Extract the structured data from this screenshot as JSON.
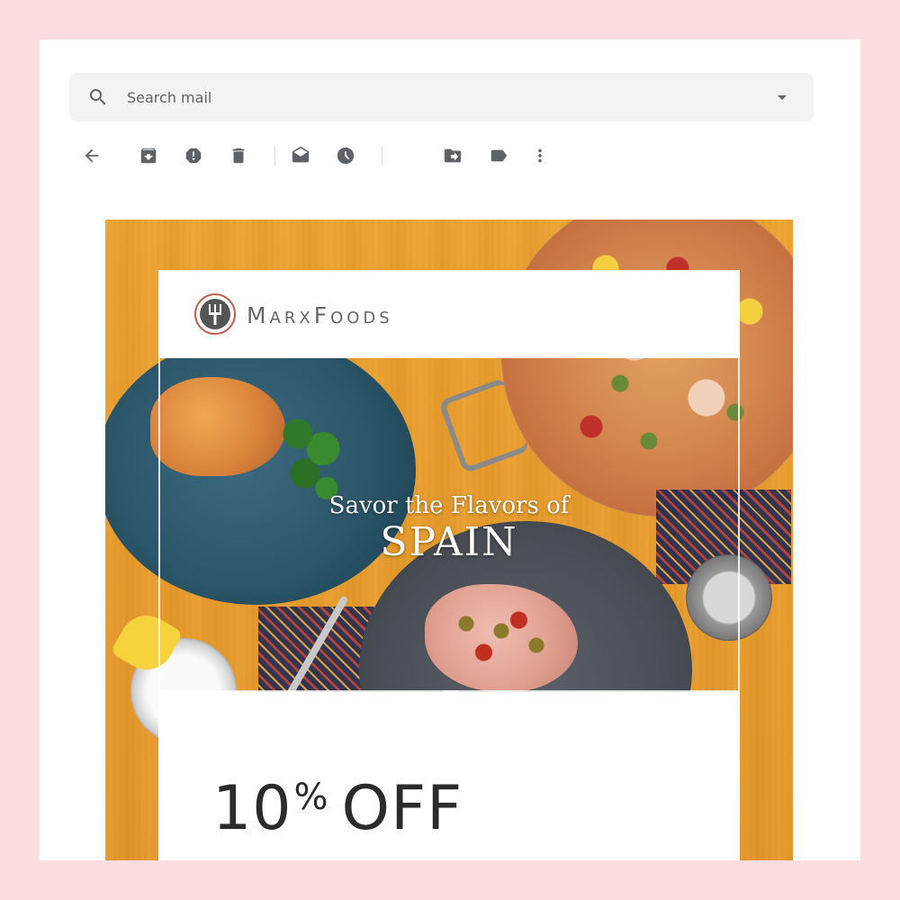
{
  "search": {
    "placeholder": "Search mail"
  },
  "toolbar": {
    "buttons": [
      "back-icon",
      "archive-icon",
      "report-spam-icon",
      "delete-icon",
      "mark-unread-icon",
      "snooze-icon",
      "move-to-icon",
      "label-icon",
      "more-icon"
    ]
  },
  "email": {
    "brand": "MarxFoods",
    "headline_line1": "Savor the Flavors of",
    "headline_line2": "SPAIN",
    "offer_number": "10",
    "offer_percent": "%",
    "offer_word": "OFF"
  },
  "colors": {
    "page_background": "#fcdde0",
    "search_background": "#f1f3f4",
    "icon_gray": "#5f6368",
    "email_background": "#eb9e2b",
    "logo_accent": "#c0604a"
  }
}
